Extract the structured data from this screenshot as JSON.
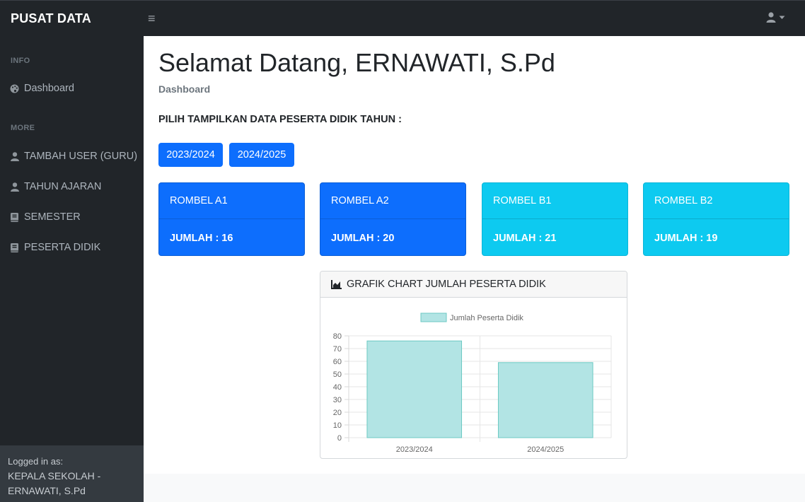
{
  "app": {
    "brand": "PUSAT DATA",
    "toggle_icon": "≡"
  },
  "sidebar": {
    "headings": [
      "INFO",
      "MORE"
    ],
    "items": [
      {
        "label": "Dashboard",
        "icon": "palette-icon"
      },
      {
        "label": "TAMBAH USER (GURU)",
        "icon": "user-icon"
      },
      {
        "label": "TAHUN AJARAN",
        "icon": "user-icon"
      },
      {
        "label": "SEMESTER",
        "icon": "book-icon"
      },
      {
        "label": "PESERTA DIDIK",
        "icon": "book-icon"
      }
    ],
    "footer": {
      "caption": "Logged in as:",
      "line1": "KEPALA SEKOLAH -",
      "line2": "ERNAWATI, S.Pd"
    }
  },
  "main": {
    "title": "Selamat Datang, ERNAWATI, S.Pd",
    "breadcrumb": "Dashboard",
    "pick_label": "PILIH TAMPILKAN DATA PESERTA DIDIK TAHUN :",
    "year_buttons": [
      "2023/2024",
      "2024/2025"
    ],
    "cards": [
      {
        "title": "ROMBEL A1",
        "count": "JUMLAH : 16",
        "color": "#0d6efd"
      },
      {
        "title": "ROMBEL A2",
        "count": "JUMLAH : 20",
        "color": "#0d6efd"
      },
      {
        "title": "ROMBEL B1",
        "count": "JUMLAH : 21",
        "color": "#0dcaf0"
      },
      {
        "title": "ROMBEL B2",
        "count": "JUMLAH : 19",
        "color": "#0dcaf0"
      }
    ],
    "chart_card_title": "GRAFIK CHART JUMLAH PESERTA DIDIK"
  },
  "colors": {
    "primary": "#0d6efd",
    "info": "#0dcaf0",
    "sidebar_bg": "#212529",
    "bar_fill": "#b2e4e4",
    "bar_stroke": "#6cc9c3"
  },
  "chart_data": {
    "type": "bar",
    "categories": [
      "2023/2024",
      "2024/2025"
    ],
    "series": [
      {
        "name": "Jumlah Peserta Didik",
        "values": [
          76,
          59
        ]
      }
    ],
    "yticks": [
      0,
      10,
      20,
      30,
      40,
      50,
      60,
      70,
      80
    ],
    "ylim": [
      0,
      80
    ],
    "legend": "top-center",
    "grid": true
  }
}
